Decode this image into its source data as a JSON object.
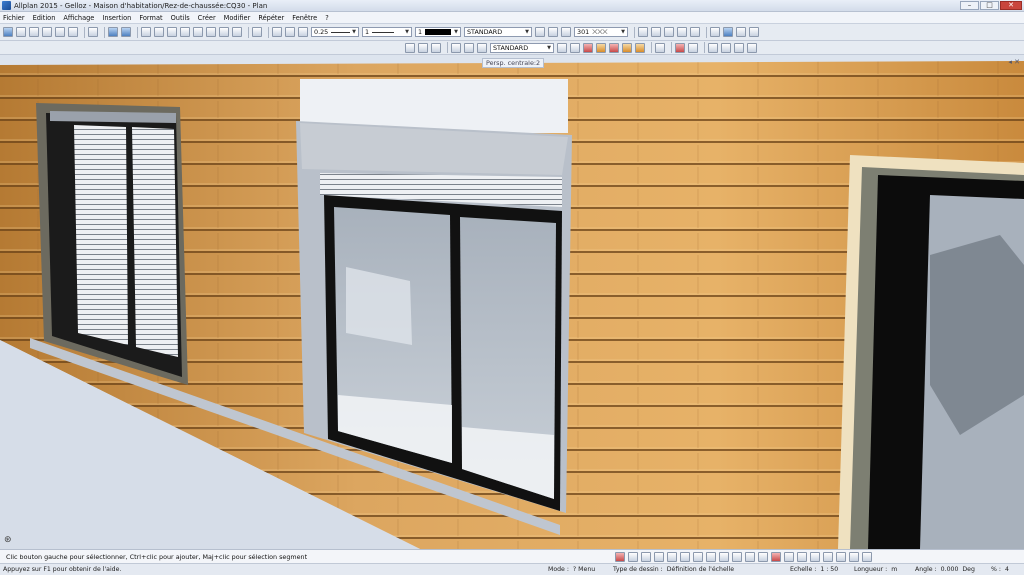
{
  "window": {
    "title": "Allplan 2015 - Gelloz - Maison d'habitation/Rez-de-chaussée:CQ30 - Plan",
    "controls": {
      "minimize": "–",
      "maximize": "□",
      "close": "✕"
    }
  },
  "menu": [
    "Fichier",
    "Edition",
    "Affichage",
    "Insertion",
    "Format",
    "Outils",
    "Créer",
    "Modifier",
    "Répéter",
    "Fenêtre",
    "?"
  ],
  "toolbar": {
    "pen_value": "0.25",
    "line_value": "1",
    "color_value": "1",
    "layer_value": "STANDARD",
    "hatch_value": "301",
    "layer2_value": "STANDARD"
  },
  "viewport": {
    "view_label": "Persp. centrale:2",
    "compass": "⊛",
    "view_controls": "◂ ✕"
  },
  "hint": "Clic bouton gauche pour sélectionner, Ctrl+clic pour ajouter, Maj+clic pour sélection segment",
  "status": {
    "help": "Appuyez sur F1 pour obtenir de l'aide.",
    "mode_label": "Mode :",
    "mode_value": "? Menu",
    "drawing_type_label": "Type de dessin :",
    "drawing_type_value": "Définition de l'échelle",
    "scale_label": "Echelle :",
    "scale_value": "1 : 50",
    "length_label": "Longueur :",
    "length_value": "m",
    "angle_label": "Angle :",
    "angle_value": "0.000",
    "angle_unit": "Deg",
    "percent_label": "% :",
    "percent_value": "4"
  },
  "colors": {
    "wood_light": "#e7b268",
    "wood_mid": "#c98a3d",
    "wood_dark": "#8e5a22",
    "frame_gray": "#a7afb9",
    "glass": "#b4bdc8",
    "sky": "#dde4ee"
  }
}
